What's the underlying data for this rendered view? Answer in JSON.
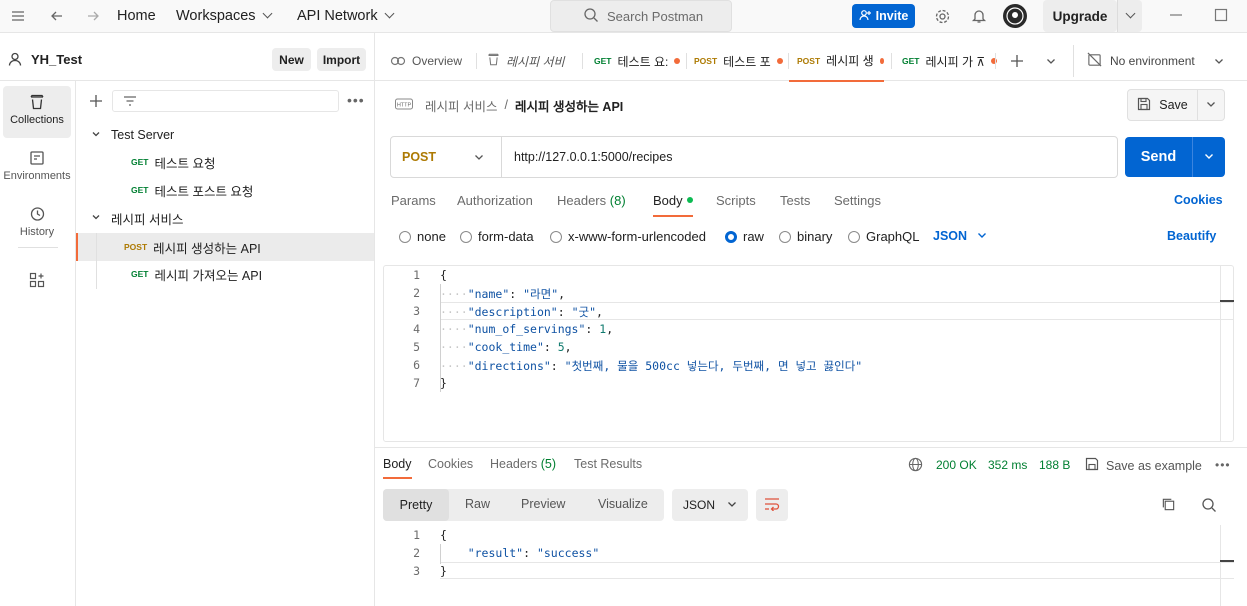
{
  "topbar": {
    "home": "Home",
    "workspaces": "Workspaces",
    "api_network": "API Network",
    "search_placeholder": "Search Postman",
    "invite": "Invite",
    "upgrade": "Upgrade"
  },
  "workspace": {
    "name": "YH_Test",
    "new_label": "New",
    "import_label": "Import"
  },
  "rail": [
    {
      "label": "Collections",
      "icon": "trash-can-icon"
    },
    {
      "label": "Environments",
      "icon": "environments-icon"
    },
    {
      "label": "History",
      "icon": "history-icon"
    }
  ],
  "tree": {
    "collections": [
      {
        "name": "Test Server",
        "requests": [
          {
            "method": "GET",
            "name": "테스트 요청"
          },
          {
            "method": "GET",
            "name": "테스트 포스트 요청"
          }
        ]
      },
      {
        "name": "레시피 서비스",
        "requests": [
          {
            "method": "POST",
            "name": "레시피 생성하는 API"
          },
          {
            "method": "GET",
            "name": "레시피 가져오는 API"
          }
        ]
      }
    ]
  },
  "tabs": {
    "overview": "Overview",
    "collection_tab": "레시피 서비",
    "items": [
      {
        "method": "GET",
        "name": "테스트 요:"
      },
      {
        "method": "POST",
        "name": "테스트 포"
      },
      {
        "method": "POST",
        "name": "레시피 생"
      },
      {
        "method": "GET",
        "name": "레시피 가 ⊼"
      }
    ],
    "environment": "No environment"
  },
  "request": {
    "breadcrumb_parent": "레시피 서비스",
    "breadcrumb_sep": "/",
    "title": "레시피 생성하는 API",
    "save": "Save",
    "method": "POST",
    "url": "http://127.0.0.1:5000/recipes",
    "send": "Send",
    "tabs": {
      "params": "Params",
      "authorization": "Authorization",
      "headers": "Headers",
      "headers_count": "(8)",
      "body": "Body",
      "scripts": "Scripts",
      "tests": "Tests",
      "settings": "Settings",
      "cookies": "Cookies"
    },
    "body_types": {
      "none": "none",
      "form_data": "form-data",
      "urlencoded": "x-www-form-urlencoded",
      "raw": "raw",
      "binary": "binary",
      "graphql": "GraphQL",
      "format": "JSON",
      "beautify": "Beautify"
    },
    "body_lines": {
      "l1": "{",
      "l2k": "\"name\"",
      "l2v": "\"라면\"",
      "l3k": "\"description\"",
      "l3v": "\"굿\"",
      "l4k": "\"num_of_servings\"",
      "l4v": "1",
      "l5k": "\"cook_time\"",
      "l5v": "5",
      "l6k": "\"directions\"",
      "l6v": "\"첫번째, 물을 500cc 넣는다, 두번째, 면 넣고 끓인다\"",
      "l7": "}"
    }
  },
  "response": {
    "tabs": {
      "body": "Body",
      "cookies": "Cookies",
      "headers": "Headers",
      "headers_count": "(5)",
      "test_results": "Test Results"
    },
    "status": "200 OK",
    "time": "352 ms",
    "size": "188 B",
    "save_example": "Save as example",
    "view_tabs": {
      "pretty": "Pretty",
      "raw": "Raw",
      "preview": "Preview",
      "visualize": "Visualize"
    },
    "format": "JSON",
    "body_lines": {
      "l1": "{",
      "l2k": "\"result\"",
      "l2v": "\"success\"",
      "l3": "}"
    }
  },
  "colors": {
    "accent": "#0265d2",
    "get": "#007f31",
    "post": "#ad7a03",
    "active_tab_line": "#f26b3a"
  }
}
